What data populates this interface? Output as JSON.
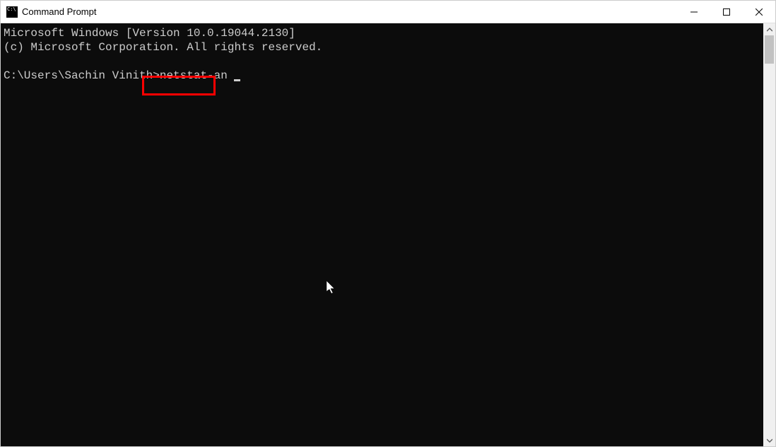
{
  "window": {
    "title": "Command Prompt"
  },
  "terminal": {
    "line1": "Microsoft Windows [Version 10.0.19044.2130]",
    "line2": "(c) Microsoft Corporation. All rights reserved.",
    "blank": "",
    "prompt": "C:\\Users\\Sachin Vinith>",
    "command": "netstat-an"
  }
}
